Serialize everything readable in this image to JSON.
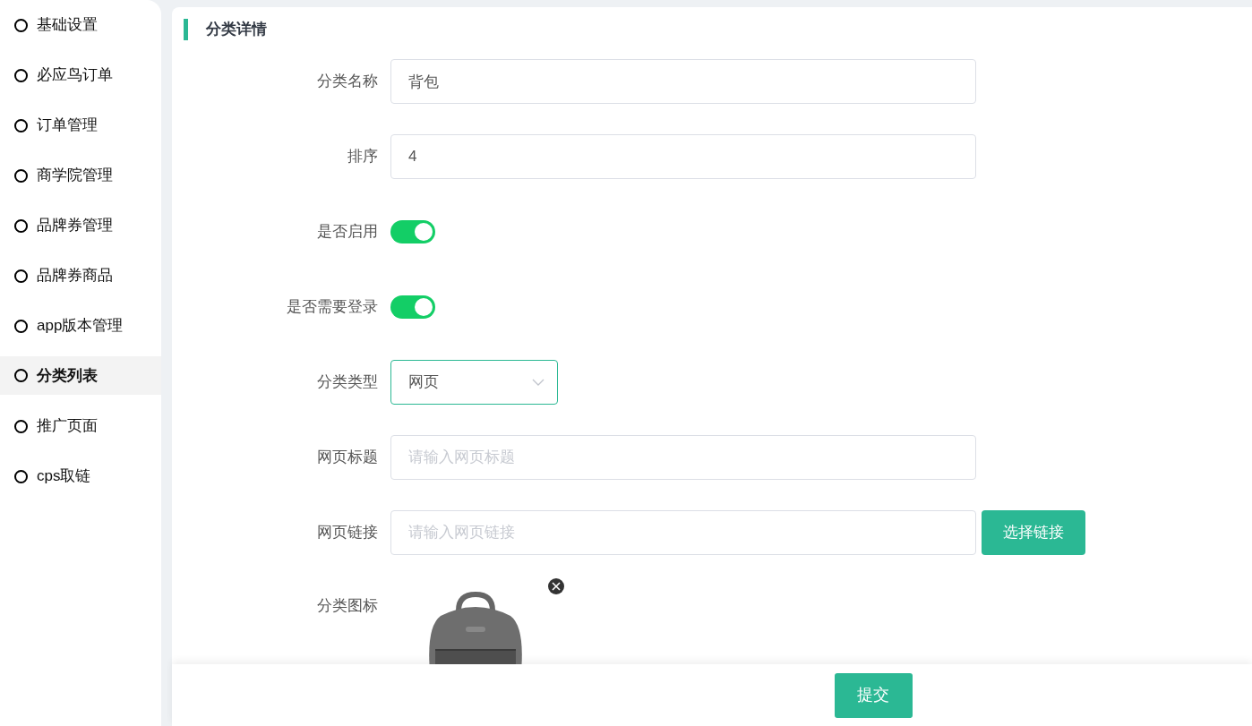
{
  "sidebar": {
    "items": [
      {
        "label": "基础设置",
        "selected": false
      },
      {
        "label": "必应鸟订单",
        "selected": false
      },
      {
        "label": "订单管理",
        "selected": false
      },
      {
        "label": "商学院管理",
        "selected": false
      },
      {
        "label": "品牌券管理",
        "selected": false
      },
      {
        "label": "品牌券商品",
        "selected": false
      },
      {
        "label": "app版本管理",
        "selected": false
      },
      {
        "label": "分类列表",
        "selected": true
      },
      {
        "label": "推广页面",
        "selected": false
      },
      {
        "label": "cps取链",
        "selected": false
      }
    ]
  },
  "panel": {
    "title": "分类详情",
    "fields": [
      {
        "kind": "text",
        "label": "分类名称",
        "value": "背包"
      },
      {
        "kind": "text",
        "label": "排序",
        "value": "4"
      },
      {
        "kind": "switch",
        "label": "是否启用",
        "on": true
      },
      {
        "kind": "switch",
        "label": "是否需要登录",
        "on": true
      },
      {
        "kind": "select",
        "label": "分类类型",
        "value": "网页"
      },
      {
        "kind": "text",
        "label": "网页标题",
        "placeholder": "请输入网页标题"
      },
      {
        "kind": "text",
        "label": "网页链接",
        "placeholder": "请输入网页链接",
        "button": "选择链接"
      },
      {
        "kind": "image",
        "label": "分类图标"
      }
    ]
  },
  "footer": {
    "submit": "提交"
  }
}
